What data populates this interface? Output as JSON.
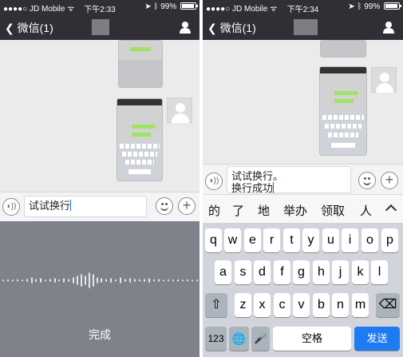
{
  "left_screen": {
    "status": {
      "carrier": "JD Mobile",
      "time": "下午2:33",
      "battery": "99%"
    },
    "nav": {
      "back_label": "微信(1)"
    },
    "input_text": "试试换行",
    "voice_done_label": "完成"
  },
  "right_screen": {
    "status": {
      "carrier": "JD Mobile",
      "time": "下午2:34",
      "battery": "99%"
    },
    "nav": {
      "back_label": "微信(1)"
    },
    "input_lines": [
      "试试换行。",
      "换行成功"
    ],
    "candidates": [
      "的",
      "了",
      "地",
      "举办",
      "领取",
      "人"
    ],
    "keyboard": {
      "row1": [
        "q",
        "w",
        "e",
        "r",
        "t",
        "y",
        "u",
        "i",
        "o",
        "p"
      ],
      "row2": [
        "a",
        "s",
        "d",
        "f",
        "g",
        "h",
        "j",
        "k",
        "l"
      ],
      "row3": [
        "z",
        "x",
        "c",
        "v",
        "b",
        "n",
        "m"
      ],
      "shift_glyph": "⇧",
      "delete_glyph": "⌫",
      "numbers_label": "123",
      "globe_glyph": "🌐",
      "mic_glyph": "🎤",
      "space_label": "空格",
      "send_label": "发送"
    }
  },
  "icons": {
    "back": "chevron-left-icon",
    "person": "person-icon",
    "voice": "voice-icon",
    "emoji": "emoji-icon",
    "plus": "plus-icon",
    "wifi": "wifi-icon",
    "battery": "battery-icon"
  },
  "colors": {
    "nav_bg": "#2f2f35",
    "chat_bg": "#ebebeb",
    "voice_panel_bg": "#7e838b",
    "keyboard_bg": "#d1d5db",
    "send_key": "#1f7bf2"
  }
}
